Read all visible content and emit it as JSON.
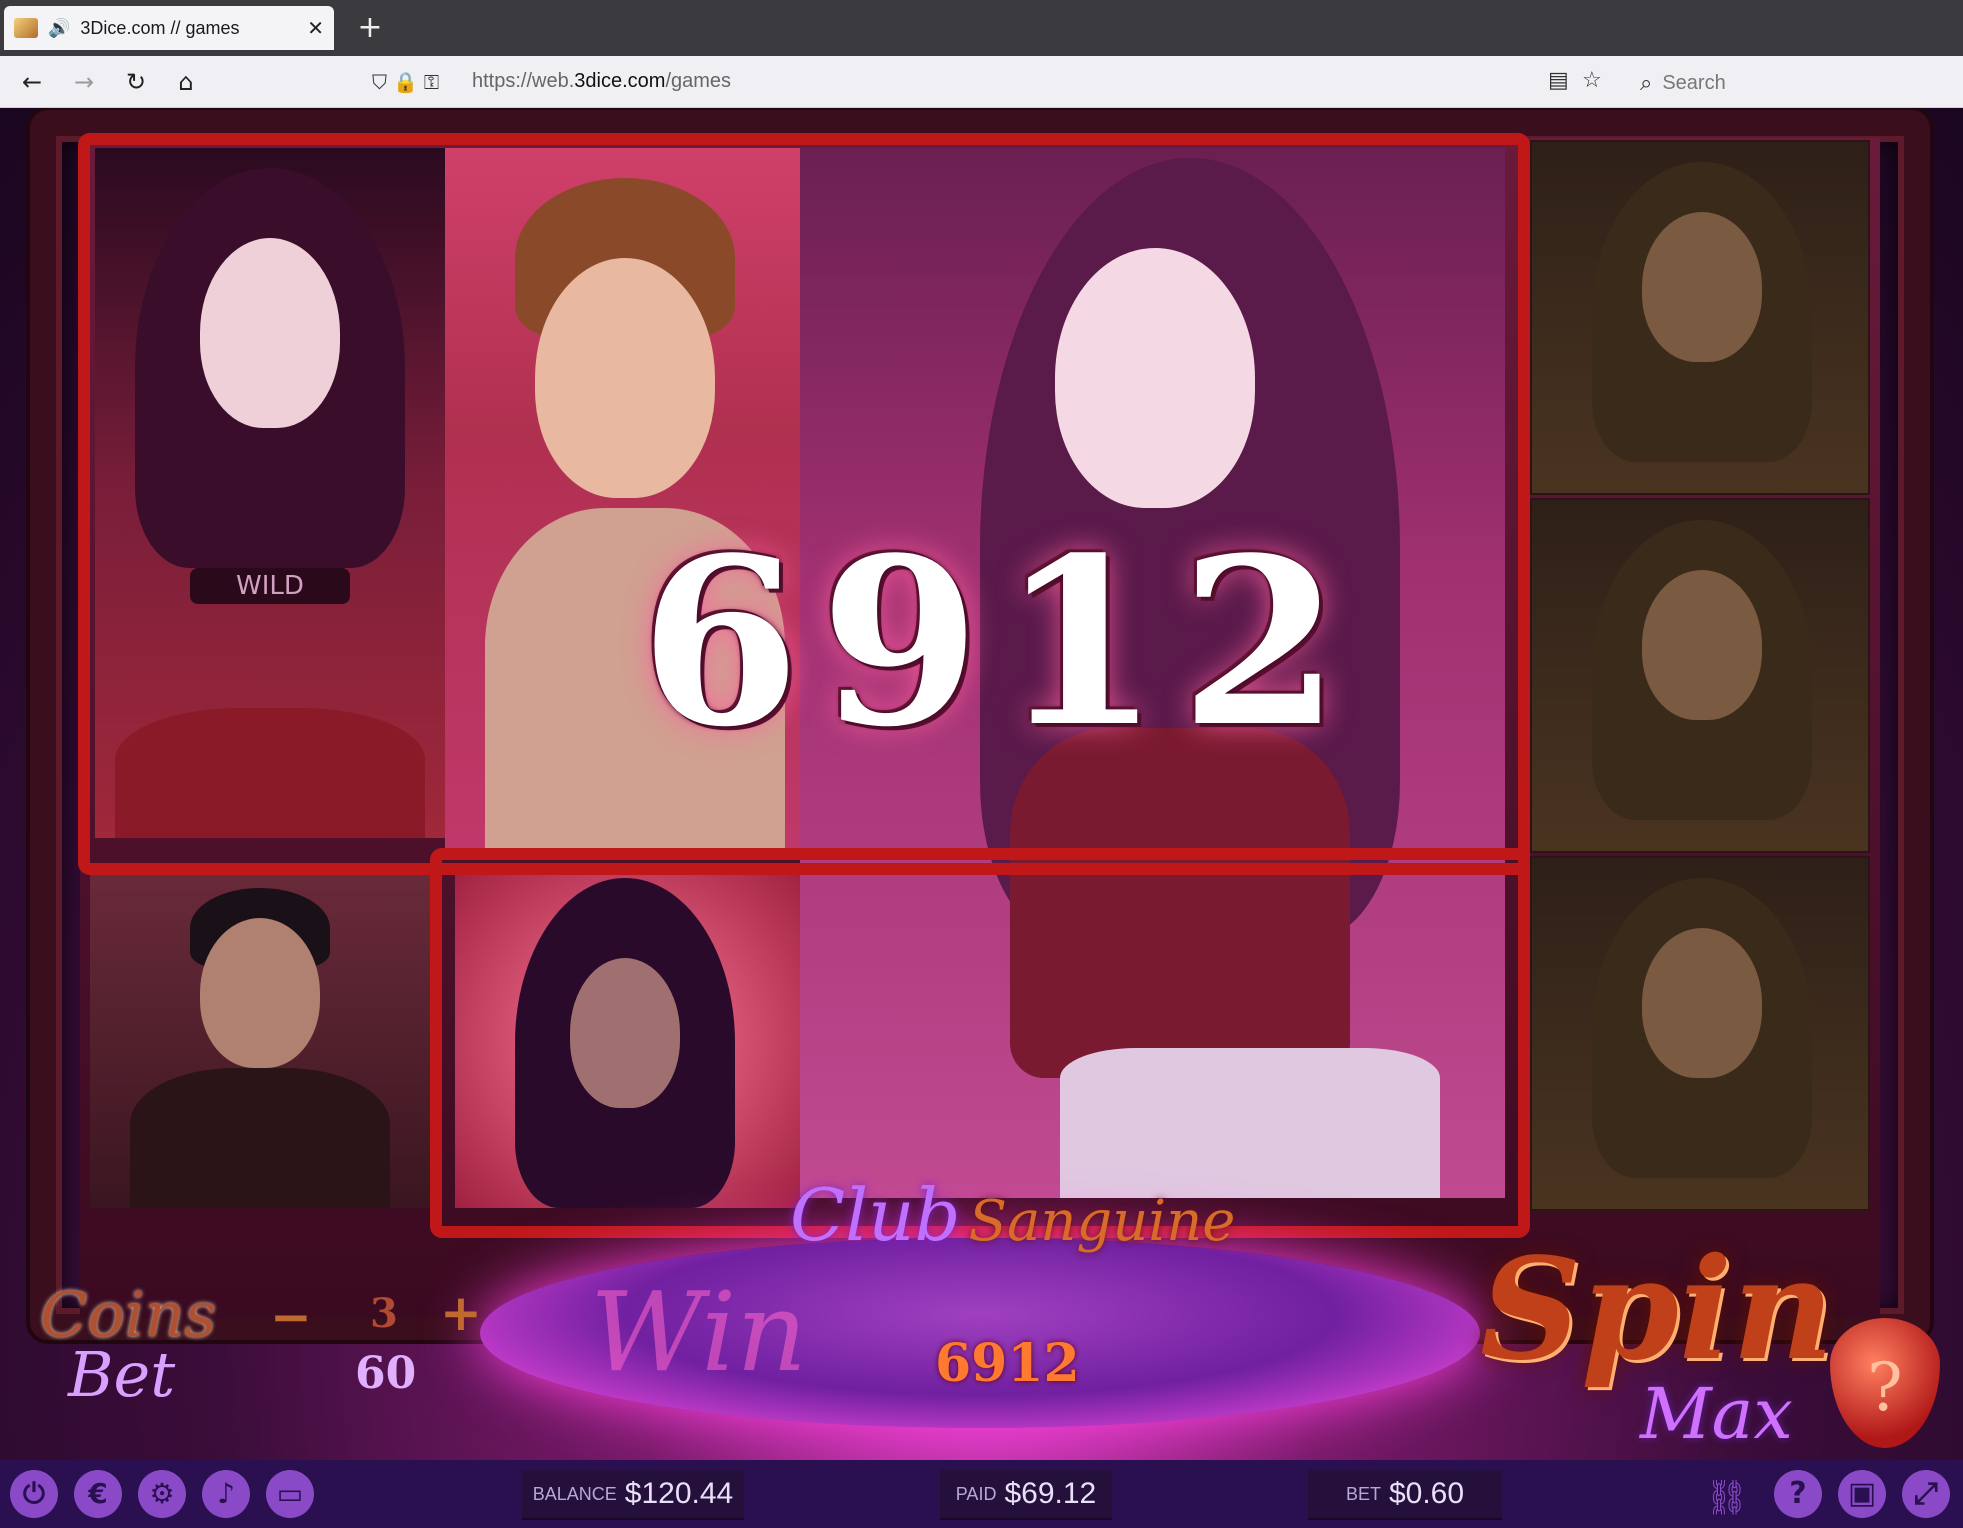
{
  "browser": {
    "tab_title": "3Dice.com // games",
    "tab_audio_icon": "speaker-icon",
    "url_prefix": "https://web.",
    "url_domain": "3dice.com",
    "url_path": "/games",
    "search_placeholder": "Search"
  },
  "game": {
    "big_win": "6912",
    "logo_part1": "Club",
    "logo_part2": "Sanguine",
    "coins_label": "Coins",
    "bet_label": "Bet",
    "coins_value": "3",
    "bet_value": "60",
    "win_label": "Win",
    "win_value": "6912",
    "spin_label": "Spin",
    "max_label": "Max",
    "help_label": "?",
    "wild_text": "WILD"
  },
  "status": {
    "balance_label": "Balance",
    "balance_value": "$120.44",
    "paid_label": "Paid",
    "paid_value": "$69.12",
    "bet_label": "Bet",
    "bet_value": "$0.60"
  },
  "colors": {
    "win_border": "#c01818",
    "status_bar": "#2a1050",
    "icon_purple": "#8a4ac8"
  }
}
